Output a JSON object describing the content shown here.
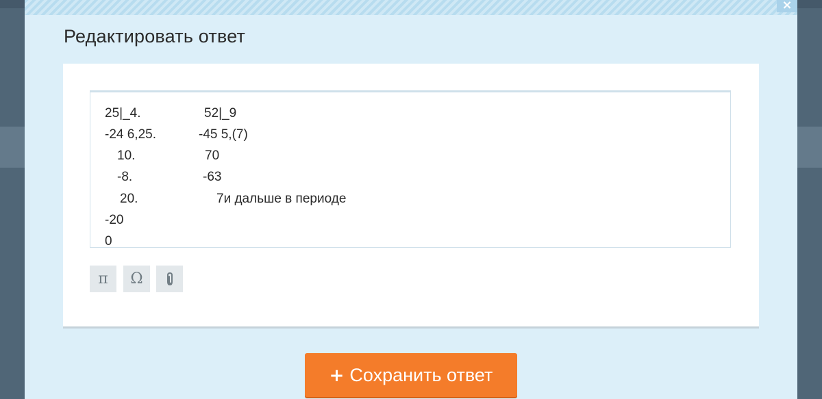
{
  "modal": {
    "title": "Редактировать ответ",
    "close_label": "×"
  },
  "editor": {
    "lines": [
      "25|_4.",
      "52|_9",
      "-24 6,25.",
      "-45 5,(7)",
      "10.",
      "70",
      "-8.",
      "-63",
      "20.",
      "7и дальше в периоде",
      "-20",
      "0"
    ]
  },
  "toolbar": {
    "pi_label": "π",
    "omega_label": "Ω",
    "attach_icon": "paperclip-icon"
  },
  "footer": {
    "save_plus": "+",
    "save_label": "Сохранить ответ"
  },
  "colors": {
    "modal_bg": "#dceff9",
    "save_button": "#f47c2a",
    "backdrop": "#506677"
  }
}
